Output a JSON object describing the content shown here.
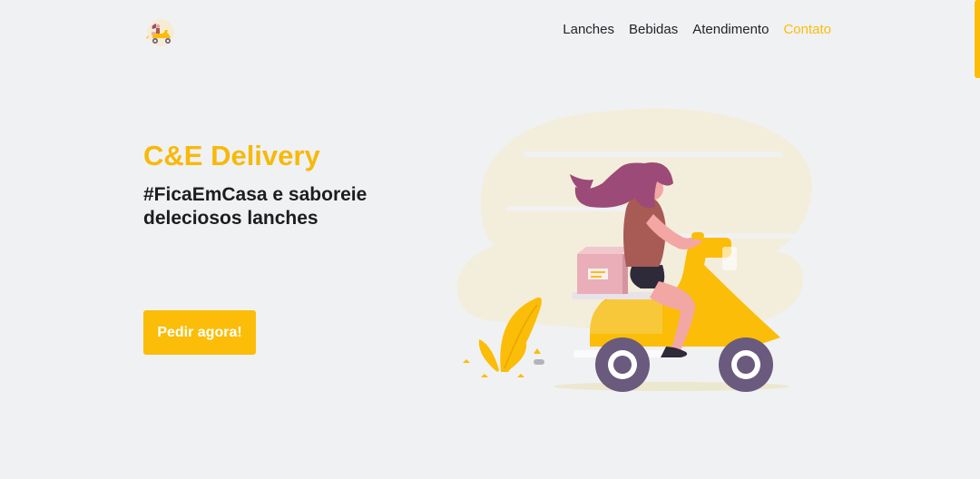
{
  "nav": {
    "links": [
      {
        "label": "Lanches"
      },
      {
        "label": "Bebidas"
      },
      {
        "label": "Atendimento"
      },
      {
        "label": "Contato"
      }
    ]
  },
  "hero": {
    "title": "C&E Delivery",
    "tagline": "#FicaEmCasa e saboreie deleciosos lanches",
    "cta_label": "Pedir agora!"
  },
  "colors": {
    "accent": "#fbbd08",
    "nav_active": "#fbbd08",
    "text": "#212529",
    "background": "#f0f1f3"
  },
  "icons": {
    "logo": "delivery-scooter-logo-icon",
    "illustration": "woman-riding-scooter-illustration"
  }
}
